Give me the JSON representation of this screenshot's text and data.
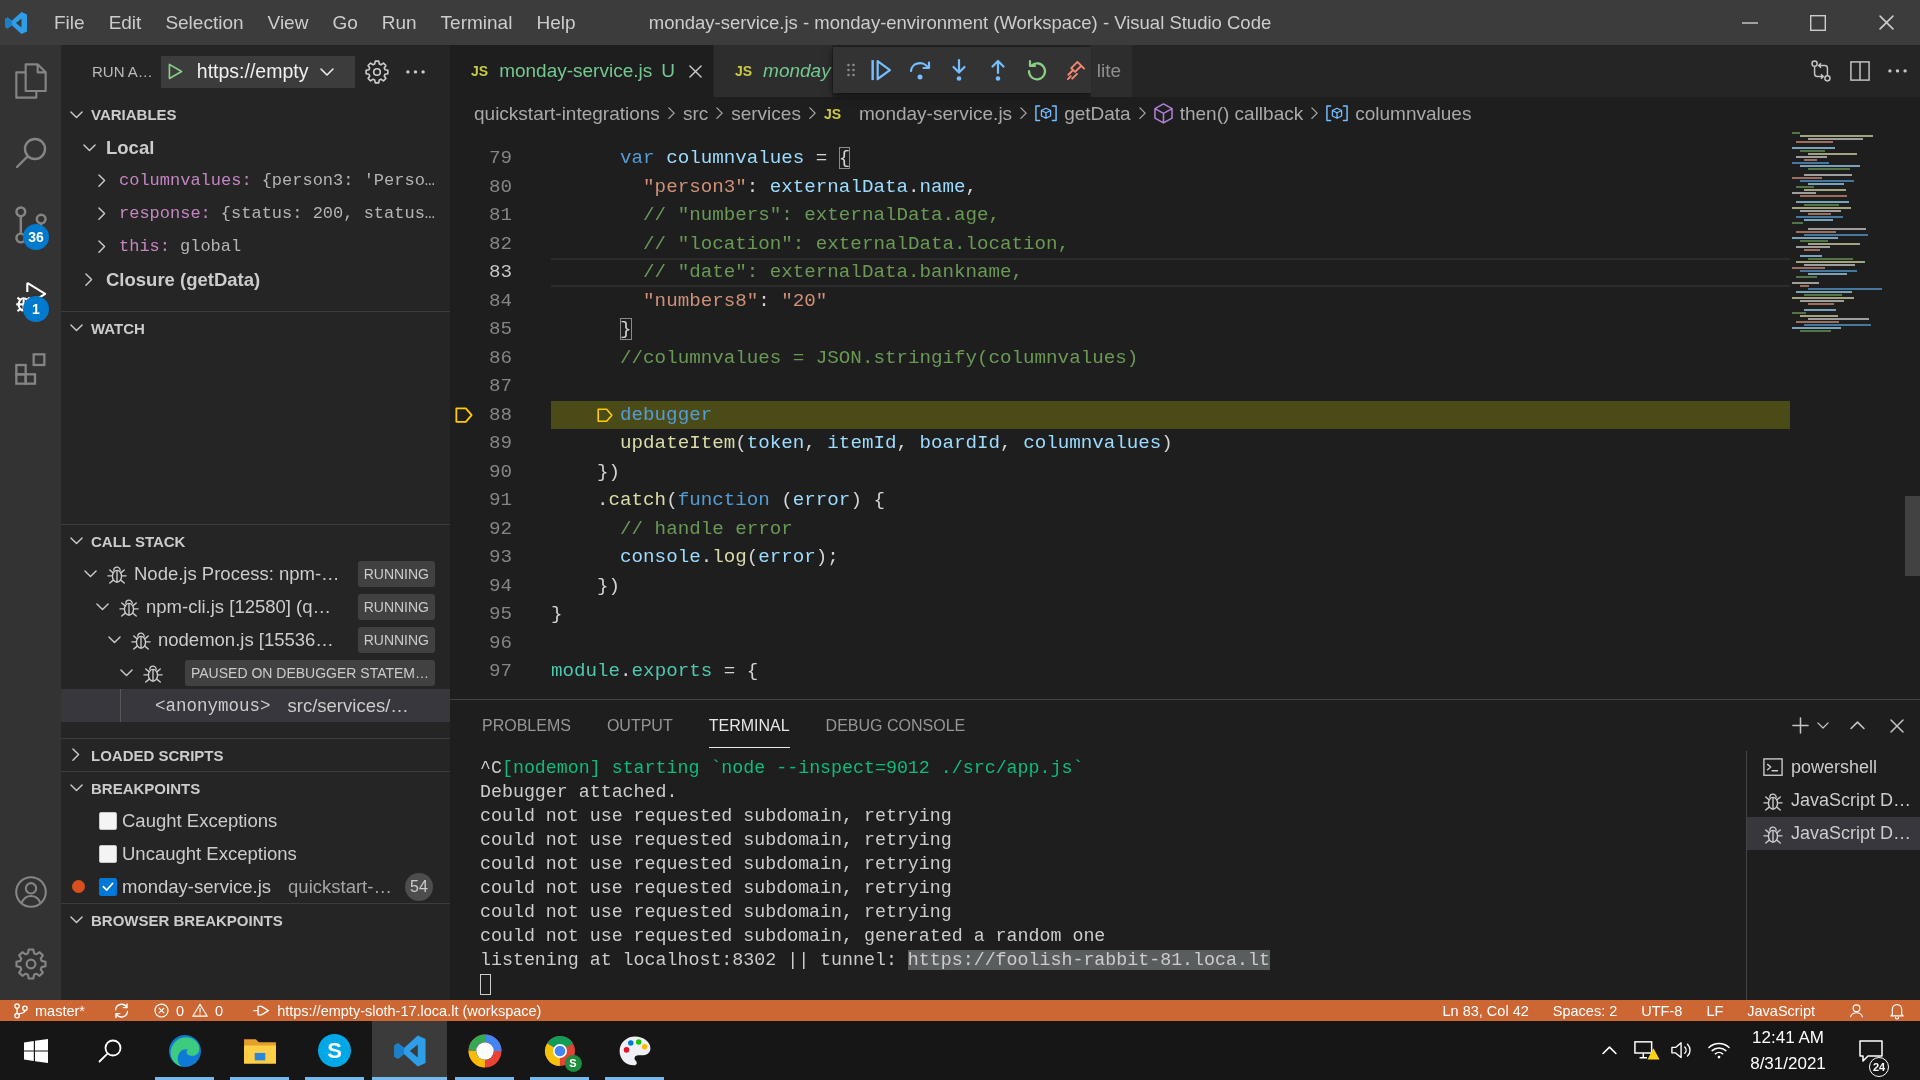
{
  "title_bar": {
    "menu": [
      "File",
      "Edit",
      "Selection",
      "View",
      "Go",
      "Run",
      "Terminal",
      "Help"
    ],
    "title": "monday-service.js - monday-environment (Workspace) - Visual Studio Code"
  },
  "activity_bar": {
    "items": [
      {
        "kind": "explorer",
        "selected": false
      },
      {
        "kind": "search",
        "selected": false
      },
      {
        "kind": "source-control",
        "selected": false,
        "badge": "36"
      },
      {
        "kind": "run-debug",
        "selected": true,
        "badge": "1"
      },
      {
        "kind": "extensions",
        "selected": false
      }
    ]
  },
  "sidebar": {
    "title": "RUN A…",
    "launch_config": "https://empty",
    "sections": [
      {
        "kind": "variables",
        "title": "VARIABLES",
        "expanded": true,
        "scopes": [
          {
            "label": "Local",
            "expanded": true,
            "variables": [
              {
                "name": "columnvalues:",
                "value": "{person3: 'Perso…",
                "expanded": false
              },
              {
                "name": "response:",
                "value": "{status: 200, status…",
                "expanded": false
              },
              {
                "name": "this:",
                "value": "global",
                "expanded": false
              }
            ]
          },
          {
            "label": "Closure (getData)",
            "expanded": false
          }
        ]
      },
      {
        "kind": "watch",
        "title": "WATCH",
        "expanded": true
      },
      {
        "kind": "call-stack",
        "title": "CALL STACK",
        "expanded": true,
        "threads": [
          {
            "label": "Node.js Process: npm-…",
            "status": "RUNNING",
            "expanded": true,
            "children": [
              {
                "label": "npm-cli.js [12580] (q…",
                "status": "RUNNING",
                "expanded": true,
                "children": [
                  {
                    "label": "nodemon.js [15536…",
                    "status": "RUNNING",
                    "expanded": true,
                    "children": [
                      {
                        "status": "PAUSED ON DEBUGGER STATEM…",
                        "expanded": true,
                        "frames": [
                          {
                            "function": "<anonymous>",
                            "source": "src/services/…",
                            "selected": true
                          }
                        ]
                      }
                    ]
                  }
                ]
              }
            ]
          }
        ]
      },
      {
        "kind": "loaded-scripts",
        "title": "LOADED SCRIPTS",
        "expanded": false
      },
      {
        "kind": "breakpoints",
        "title": "BREAKPOINTS",
        "expanded": true,
        "items": [
          {
            "kind": "exception",
            "label": "Caught Exceptions",
            "checked": false
          },
          {
            "kind": "exception",
            "label": "Uncaught Exceptions",
            "checked": false
          },
          {
            "kind": "source",
            "label": "monday-service.js",
            "detail": "quickstart-…",
            "line": "54",
            "checked": true
          }
        ]
      },
      {
        "kind": "browser-breakpoints",
        "title": "BROWSER BREAKPOINTS",
        "expanded": true
      }
    ]
  },
  "editor": {
    "tabs": [
      {
        "icon_text": "JS",
        "label": "monday-service.js",
        "untracked": true,
        "decoration": "U",
        "selected": true,
        "preview": false
      },
      {
        "icon_text": "JS",
        "label": "monday",
        "untracked": true,
        "selected": false,
        "preview": true
      },
      {
        "label": "lite",
        "untracked": false,
        "selected": false,
        "preview": false
      }
    ],
    "breadcrumbs": [
      {
        "kind": "folder",
        "label": "quickstart-integrations"
      },
      {
        "kind": "folder",
        "label": "src"
      },
      {
        "kind": "folder",
        "label": "services"
      },
      {
        "kind": "file",
        "icon_text": "JS",
        "label": "monday-service.js"
      },
      {
        "kind": "variable",
        "label": "getData"
      },
      {
        "kind": "method",
        "label": "then() callback"
      },
      {
        "kind": "variable",
        "label": "columnvalues"
      }
    ],
    "lines": [
      {
        "number": "79",
        "current": false,
        "paused": false,
        "tokens": [
          {
            "text": "      var",
            "kind": "keyword"
          },
          {
            "text": " columnvalues",
            "kind": "variable"
          },
          {
            "text": " = ",
            "kind": "plain"
          },
          {
            "text": "{",
            "kind": "bracket-match"
          }
        ]
      },
      {
        "number": "80",
        "current": false,
        "paused": false,
        "tokens": [
          {
            "text": "        \"person3\"",
            "kind": "string"
          },
          {
            "text": ": ",
            "kind": "plain"
          },
          {
            "text": "externalData",
            "kind": "variable"
          },
          {
            "text": ".",
            "kind": "plain"
          },
          {
            "text": "name",
            "kind": "variable"
          },
          {
            "text": ",",
            "kind": "plain"
          }
        ]
      },
      {
        "number": "81",
        "current": false,
        "paused": false,
        "tokens": [
          {
            "text": "        // \"numbers\": externalData.age,",
            "kind": "comment"
          }
        ]
      },
      {
        "number": "82",
        "current": false,
        "paused": false,
        "tokens": [
          {
            "text": "        // \"location\": externalData.location,",
            "kind": "comment"
          }
        ]
      },
      {
        "number": "83",
        "current": true,
        "paused": false,
        "tokens": [
          {
            "text": "        // \"date\": externalData.bankname,",
            "kind": "comment"
          }
        ]
      },
      {
        "number": "84",
        "current": false,
        "paused": false,
        "tokens": [
          {
            "text": "        \"numbers8\"",
            "kind": "string"
          },
          {
            "text": ": ",
            "kind": "plain"
          },
          {
            "text": "\"20\"",
            "kind": "string"
          }
        ]
      },
      {
        "number": "85",
        "current": false,
        "paused": false,
        "tokens": [
          {
            "text": "      }",
            "kind": "bracket-match"
          }
        ]
      },
      {
        "number": "86",
        "current": false,
        "paused": false,
        "tokens": [
          {
            "text": "      //columnvalues = JSON.stringify(columnvalues)",
            "kind": "comment"
          }
        ]
      },
      {
        "number": "87",
        "current": false,
        "paused": false
      },
      {
        "number": "88",
        "current": false,
        "paused": true,
        "tokens": [
          {
            "text": "      debugger",
            "kind": "keyword"
          }
        ]
      },
      {
        "number": "89",
        "current": false,
        "paused": false,
        "tokens": [
          {
            "text": "      updateItem",
            "kind": "function"
          },
          {
            "text": "(",
            "kind": "plain"
          },
          {
            "text": "token",
            "kind": "variable"
          },
          {
            "text": ", ",
            "kind": "plain"
          },
          {
            "text": "itemId",
            "kind": "variable"
          },
          {
            "text": ", ",
            "kind": "plain"
          },
          {
            "text": "boardId",
            "kind": "variable"
          },
          {
            "text": ", ",
            "kind": "plain"
          },
          {
            "text": "columnvalues",
            "kind": "variable"
          },
          {
            "text": ")",
            "kind": "plain"
          }
        ]
      },
      {
        "number": "90",
        "current": false,
        "paused": false,
        "tokens": [
          {
            "text": "    })",
            "kind": "plain"
          }
        ]
      },
      {
        "number": "91",
        "current": false,
        "paused": false,
        "tokens": [
          {
            "text": "    .",
            "kind": "plain"
          },
          {
            "text": "catch",
            "kind": "function"
          },
          {
            "text": "(",
            "kind": "plain"
          },
          {
            "text": "function",
            "kind": "keyword"
          },
          {
            "text": " (",
            "kind": "plain"
          },
          {
            "text": "error",
            "kind": "variable"
          },
          {
            "text": ") {",
            "kind": "plain"
          }
        ]
      },
      {
        "number": "92",
        "current": false,
        "paused": false,
        "tokens": [
          {
            "text": "      // handle error",
            "kind": "comment"
          }
        ]
      },
      {
        "number": "93",
        "current": false,
        "paused": false,
        "tokens": [
          {
            "text": "      console",
            "kind": "variable"
          },
          {
            "text": ".",
            "kind": "plain"
          },
          {
            "text": "log",
            "kind": "function"
          },
          {
            "text": "(",
            "kind": "plain"
          },
          {
            "text": "error",
            "kind": "variable"
          },
          {
            "text": ");",
            "kind": "plain"
          }
        ]
      },
      {
        "number": "94",
        "current": false,
        "paused": false,
        "tokens": [
          {
            "text": "    })",
            "kind": "plain"
          }
        ]
      },
      {
        "number": "95",
        "current": false,
        "paused": false,
        "tokens": [
          {
            "text": "}",
            "kind": "plain"
          }
        ]
      },
      {
        "number": "96",
        "current": false,
        "paused": false
      },
      {
        "number": "97",
        "current": false,
        "paused": false,
        "tokens": [
          {
            "text": "module",
            "kind": "type"
          },
          {
            "text": ".",
            "kind": "plain"
          },
          {
            "text": "exports",
            "kind": "type"
          },
          {
            "text": " = {",
            "kind": "plain"
          }
        ]
      }
    ]
  },
  "panel": {
    "tabs": [
      {
        "label": "PROBLEMS",
        "selected": false
      },
      {
        "label": "OUTPUT",
        "selected": false
      },
      {
        "label": "TERMINAL",
        "selected": true
      },
      {
        "label": "DEBUG CONSOLE",
        "selected": false
      }
    ],
    "terminal": {
      "cursor": true,
      "lines": [
        {
          "segments": [
            {
              "text": "^C",
              "kind": "plain",
              "selected": false
            },
            {
              "text": "[nodemon] starting `node --inspect=9012 ./src/app.js`",
              "kind": "success",
              "selected": false
            }
          ]
        },
        {
          "segments": [
            {
              "text": "Debugger attached.",
              "kind": "plain",
              "selected": false
            }
          ]
        },
        {
          "segments": [
            {
              "text": "could not use requested subdomain, retrying",
              "kind": "plain",
              "selected": false
            }
          ]
        },
        {
          "segments": [
            {
              "text": "could not use requested subdomain, retrying",
              "kind": "plain",
              "selected": false
            }
          ]
        },
        {
          "segments": [
            {
              "text": "could not use requested subdomain, retrying",
              "kind": "plain",
              "selected": false
            }
          ]
        },
        {
          "segments": [
            {
              "text": "could not use requested subdomain, retrying",
              "kind": "plain",
              "selected": false
            }
          ]
        },
        {
          "segments": [
            {
              "text": "could not use requested subdomain, retrying",
              "kind": "plain",
              "selected": false
            }
          ]
        },
        {
          "segments": [
            {
              "text": "could not use requested subdomain, generated a random one",
              "kind": "plain",
              "selected": false
            }
          ]
        },
        {
          "segments": [
            {
              "text": "listening at localhost:8302 || tunnel: ",
              "kind": "plain",
              "selected": false
            },
            {
              "text": "https://foolish-rabbit-81.loca.lt",
              "kind": "link",
              "selected": true
            }
          ]
        }
      ]
    },
    "terminals": [
      {
        "kind": "shell",
        "label": "powershell",
        "selected": false
      },
      {
        "kind": "debug",
        "label": "JavaScript D…",
        "selected": false
      },
      {
        "kind": "debug",
        "label": "JavaScript D…",
        "selected": true
      }
    ]
  },
  "status_bar": {
    "debugging": true,
    "branch": "master*",
    "errors": "0",
    "warnings": "0",
    "debug_target": "https://empty-sloth-17.loca.lt (workspace)",
    "right": [
      "Ln 83, Col 42",
      "Spaces: 2",
      "UTF-8",
      "LF",
      "JavaScript"
    ]
  },
  "taskbar": {
    "apps": [
      {
        "kind": "edge",
        "running": true,
        "selected": false
      },
      {
        "kind": "file-explorer",
        "running": true,
        "selected": false
      },
      {
        "kind": "skype",
        "letter": "S",
        "running": true,
        "selected": false
      },
      {
        "kind": "vscode",
        "running": true,
        "selected": true
      },
      {
        "kind": "color-ring",
        "running": true,
        "selected": false
      },
      {
        "kind": "chrome",
        "letter": "S",
        "running": true,
        "selected": false
      },
      {
        "kind": "paint",
        "running": true,
        "selected": false
      }
    ],
    "clock": {
      "time": "12:41 AM",
      "date": "8/31/2021"
    },
    "notifications": "24"
  }
}
